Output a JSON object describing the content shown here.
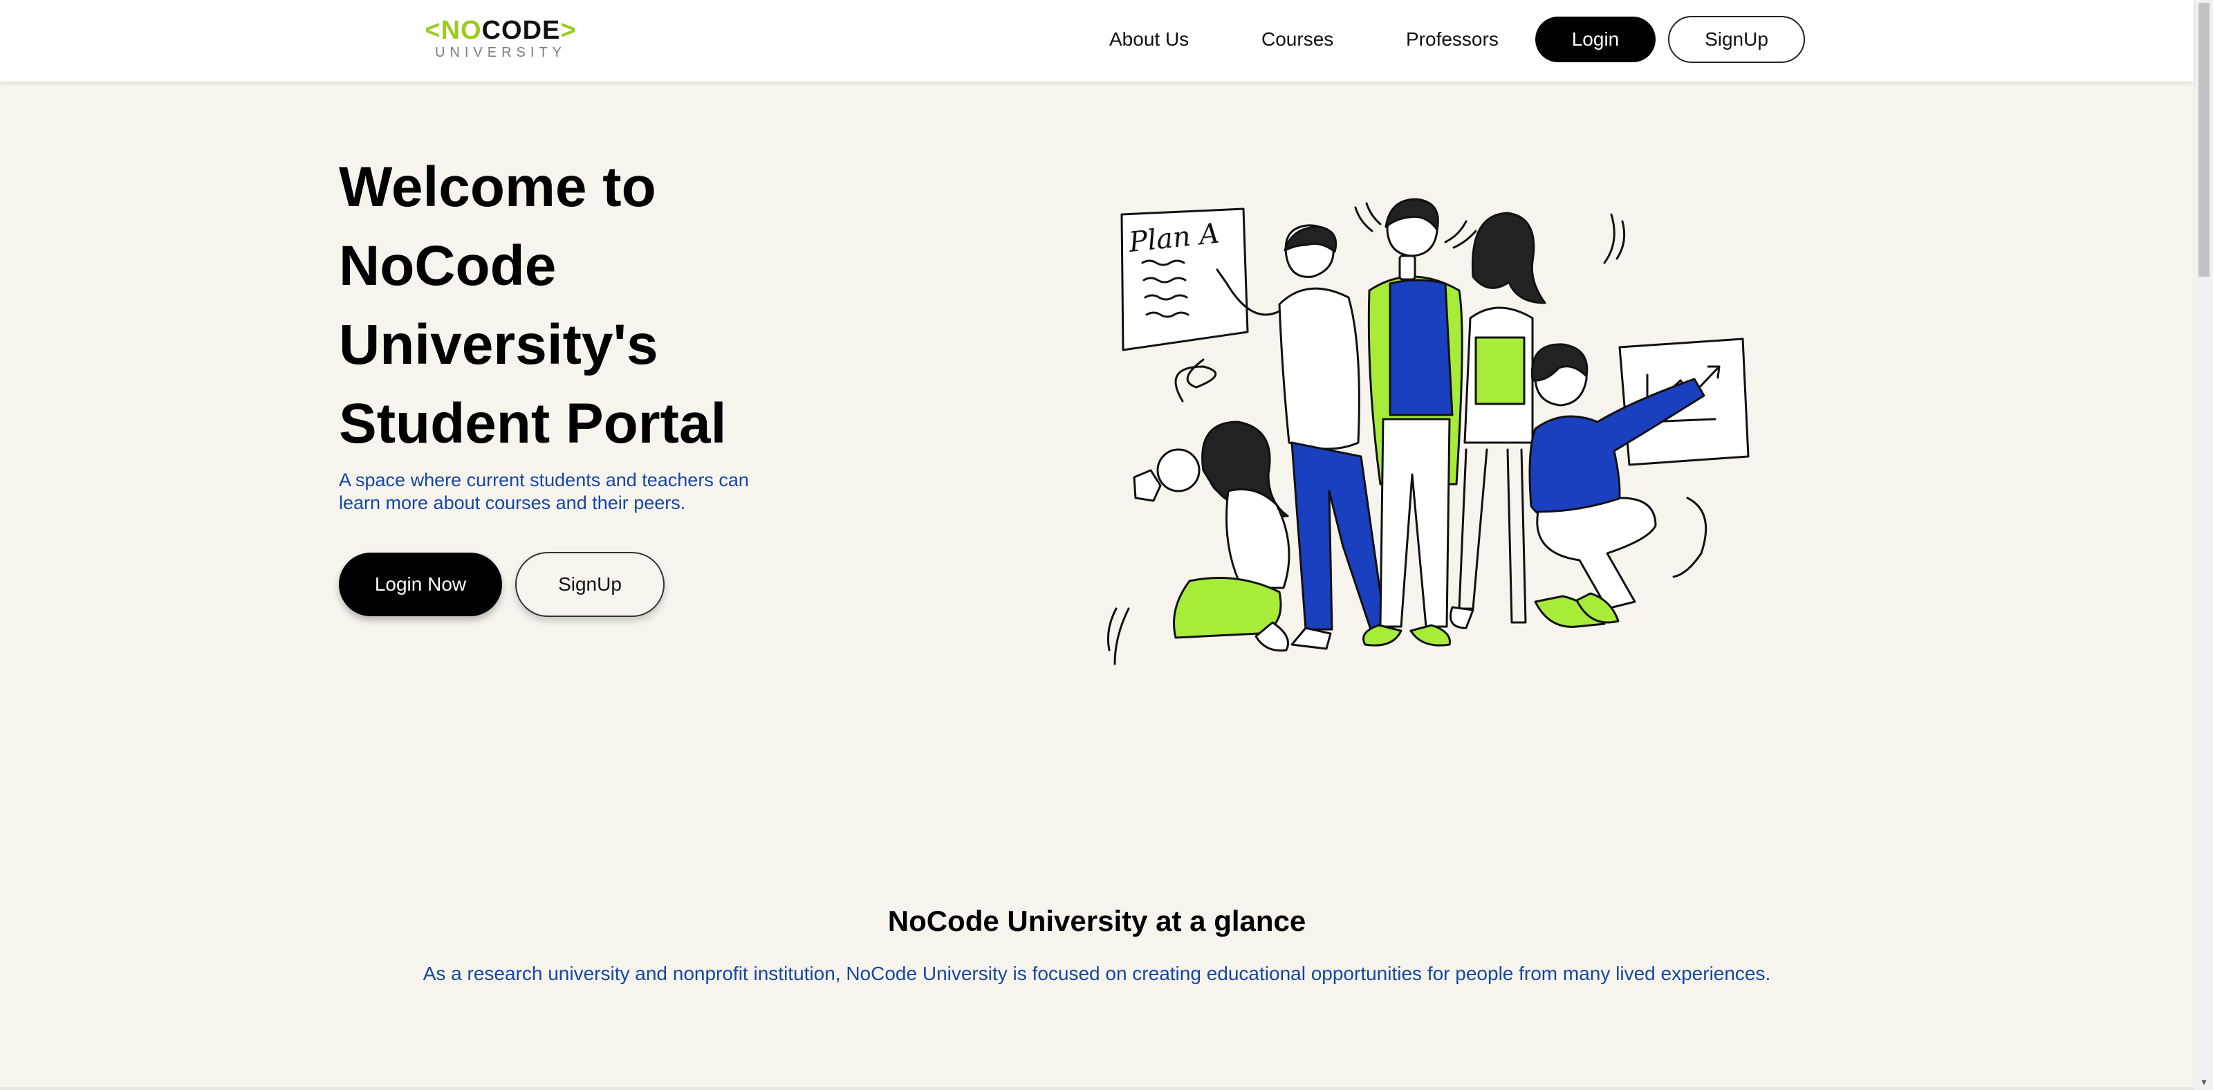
{
  "header": {
    "logo": {
      "left_bracket": "<",
      "no": "NO",
      "code": "CODE",
      "right_bracket": ">",
      "subtitle": "UNIVERSITY"
    },
    "nav": {
      "about": "About Us",
      "courses": "Courses",
      "professors": "Professors",
      "login": "Login",
      "signup": "SignUp"
    }
  },
  "hero": {
    "title_lines": [
      "Welcome to",
      "NoCode",
      "University's",
      "Student Portal"
    ],
    "subtitle": "A space where current students and teachers can learn more about courses and their peers.",
    "login_button": "Login Now",
    "signup_button": "SignUp",
    "illustration": {
      "board_text": "Plan A"
    }
  },
  "glance": {
    "title": "NoCode University at a glance",
    "text": "As a research university and nonprofit institution, NoCode University is focused on creating educational opportunities for people from many lived experiences."
  },
  "colors": {
    "background": "#f7f4ed",
    "brand_green": "#9ccb1f",
    "accent_blue": "#1546a6",
    "illustration_blue": "#1a3fbf",
    "illustration_green": "#a8ec3a"
  }
}
